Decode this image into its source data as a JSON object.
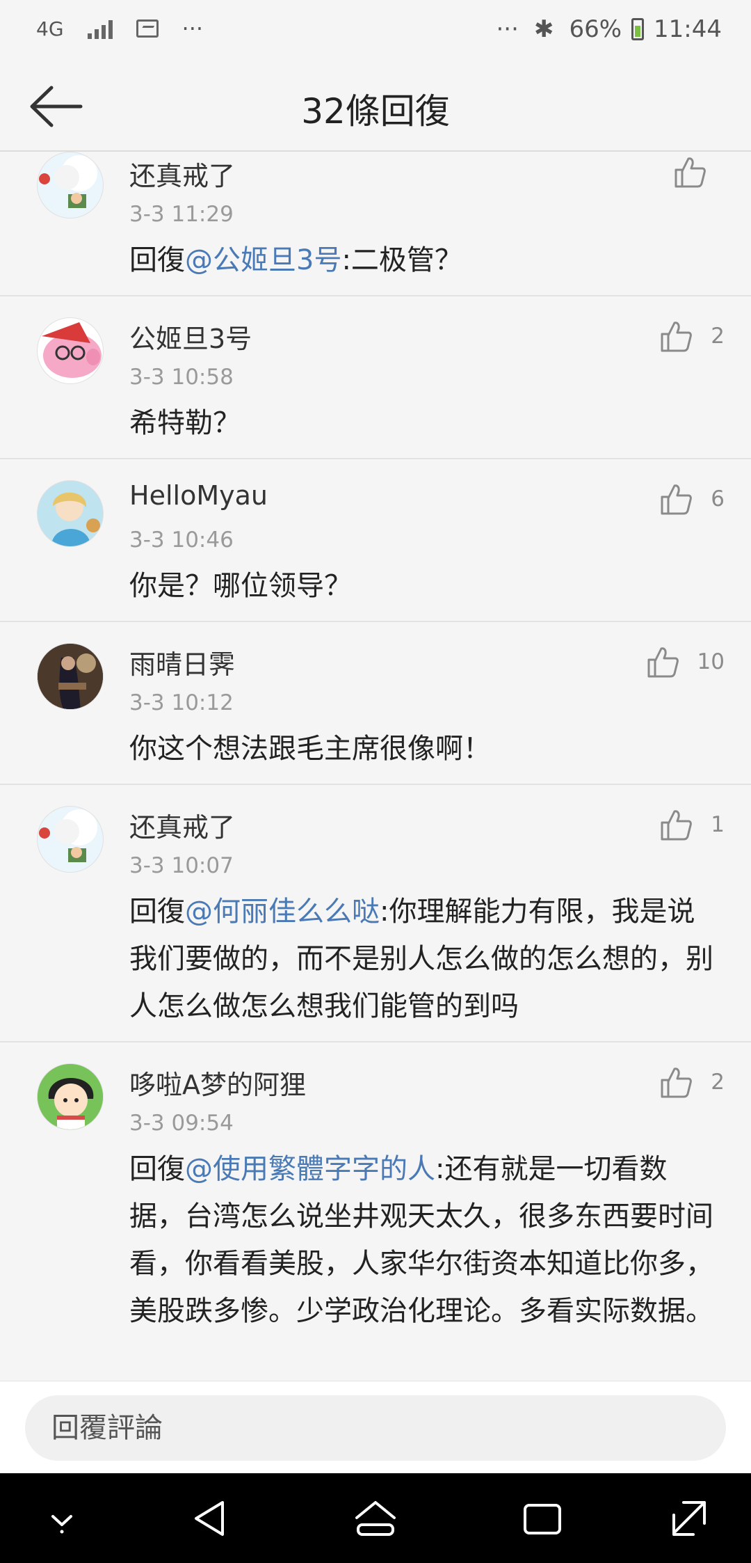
{
  "status_bar": {
    "network": "4G",
    "dots_left": "···",
    "dots_right": "···",
    "bluetooth": "✱",
    "battery": "66%",
    "time": "11:44"
  },
  "header": {
    "title": "32條回復"
  },
  "comments": [
    {
      "user": "还真戒了",
      "time": "3-3 11:29",
      "prefix": "回復",
      "mention": "@公姬旦3号",
      "text": ":二极管？",
      "likes": ""
    },
    {
      "user": "公姬旦3号",
      "time": "3-3 10:58",
      "prefix": "",
      "mention": "",
      "text": "希特勒？",
      "likes": "2"
    },
    {
      "user": "HelloMyau",
      "time": "3-3 10:46",
      "prefix": "",
      "mention": "",
      "text": "你是？哪位领导？",
      "likes": "6"
    },
    {
      "user": "雨晴日霁",
      "time": "3-3 10:12",
      "prefix": "",
      "mention": "",
      "text": "你这个想法跟毛主席很像啊！",
      "likes": "10"
    },
    {
      "user": "还真戒了",
      "time": "3-3 10:07",
      "prefix": "回復",
      "mention": "@何丽佳么么哒",
      "text": ":你理解能力有限，我是说我们要做的，而不是别人怎么做的怎么想的，别人怎么做怎么想我们能管的到吗",
      "likes": "1"
    },
    {
      "user": "哆啦A梦的阿狸",
      "time": "3-3 09:54",
      "prefix": "回復",
      "mention": "@使用繁體字字的人",
      "text": ":还有就是一切看数据，台湾怎么说坐井观天太久，很多东西要时间看，你看看美股，人家华尔街资本知道比你多，美股跌多惨。少学政治化理论。多看实际数据。",
      "likes": "2"
    }
  ],
  "reply_bar": {
    "placeholder": "回覆評論"
  },
  "icons": {
    "back": "back-arrow-icon",
    "like": "thumbs-up-icon",
    "nav": [
      "nav-down-icon",
      "nav-back-icon",
      "nav-home-icon",
      "nav-recents-icon",
      "nav-expand-icon"
    ]
  },
  "colors": {
    "mention": "#4a7ab5",
    "battery": "#7cc043"
  }
}
